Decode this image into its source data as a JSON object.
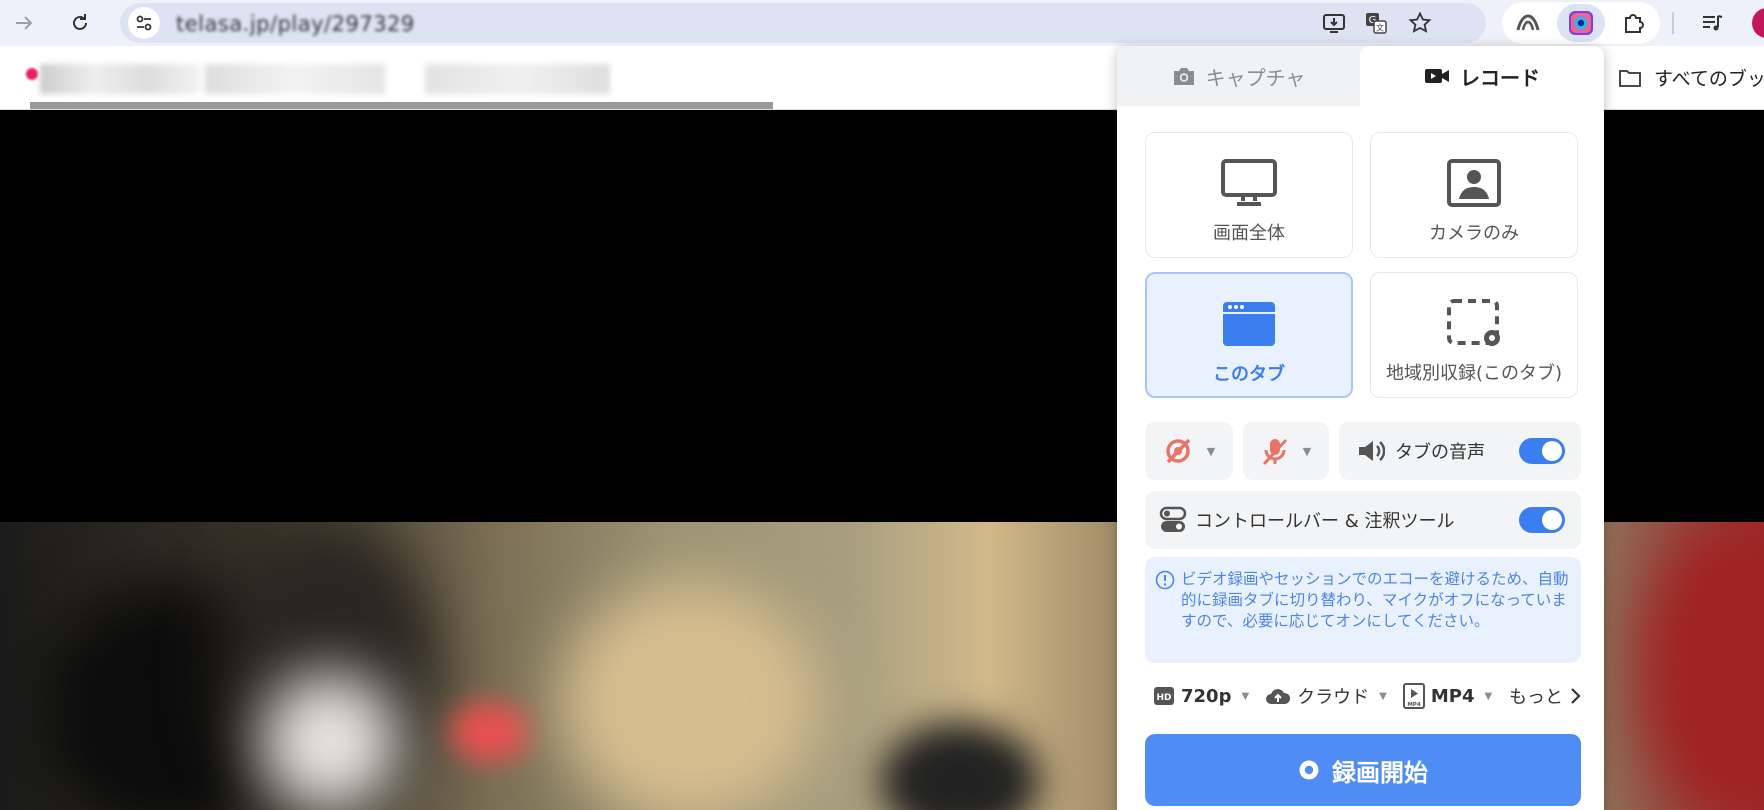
{
  "browser": {
    "url": "telasa.jp/play/297329",
    "bookmarks_folder_label": "すべてのブック"
  },
  "popup": {
    "tabs": [
      {
        "label": "キャプチャ",
        "active": false
      },
      {
        "label": "レコード",
        "active": true
      }
    ],
    "modes": [
      {
        "label": "画面全体",
        "icon": "monitor-icon",
        "selected": false
      },
      {
        "label": "カメラのみ",
        "icon": "camera-portrait-icon",
        "selected": false
      },
      {
        "label": "このタブ",
        "icon": "browser-tab-icon",
        "selected": true
      },
      {
        "label": "地域別収録(このタブ)",
        "icon": "region-select-icon",
        "selected": false
      }
    ],
    "tab_audio_label": "タブの音声",
    "tab_audio_on": true,
    "controlbar_label": "コントロールバー & 注釈ツール",
    "controlbar_on": true,
    "notice": "ビデオ録画やセッションでのエコーを避けるため、自動的に録画タブに切り替わり、マイクがオフになっていますので、必要に応じてオンにしてください。",
    "options": {
      "resolution": "720p",
      "storage": "クラウド",
      "format": "MP4",
      "more": "もっと"
    },
    "start_button": "録画開始"
  },
  "colors": {
    "accent": "#4f8df5",
    "muted_red": "#e8746a"
  }
}
